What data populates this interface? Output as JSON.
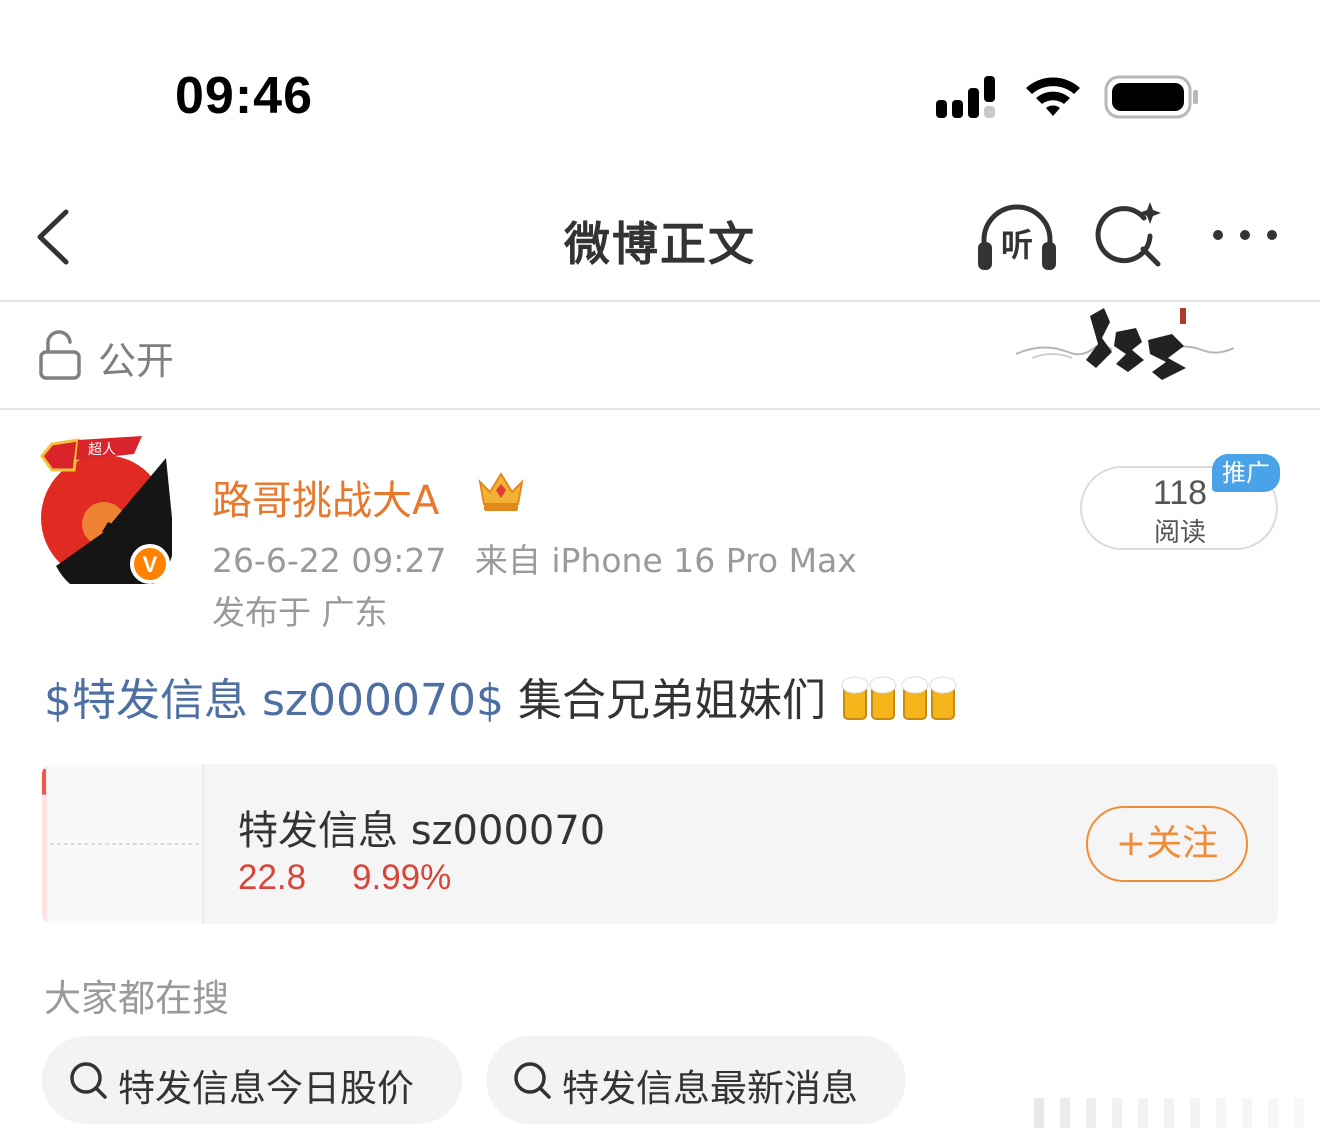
{
  "status_bar": {
    "time": "09:46",
    "icons": [
      "signal-icon",
      "wifi-icon",
      "battery-icon"
    ]
  },
  "nav": {
    "title": "微博正文",
    "listen_label": "听",
    "icons": [
      "back-icon",
      "listen-icon",
      "search-ai-icon",
      "more-icon"
    ]
  },
  "visibility": {
    "label": "公开",
    "icon": "lock-icon"
  },
  "post": {
    "author": {
      "name": "路哥挑战大A",
      "avatar_badge_text": "超人",
      "verified_mark": "V"
    },
    "timestamp": "26-6-22 09:27",
    "source": "来自 iPhone 16 Pro Max",
    "location": "发布于 广东",
    "read_count": "118",
    "read_label": "阅读",
    "ad_badge": "推广",
    "body": {
      "stock_tag": "$特发信息 sz000070$",
      "text": " 集合兄弟姐妹们",
      "emoji": [
        "beer-icon",
        "beer-icon"
      ]
    }
  },
  "stock_card": {
    "name": "特发信息 sz000070",
    "price": "22.8",
    "change": "9.99%",
    "follow_label": "+关注",
    "colors": {
      "up": "#d9453a",
      "follow": "#ef8d3a"
    }
  },
  "trending": {
    "title": "大家都在搜",
    "items": [
      {
        "label": "特发信息今日股价"
      },
      {
        "label": "特发信息最新消息"
      }
    ]
  },
  "colors": {
    "author_name": "#e8792c",
    "stock_tag": "#4d6fa3",
    "ad_badge": "#4aa3e8"
  }
}
